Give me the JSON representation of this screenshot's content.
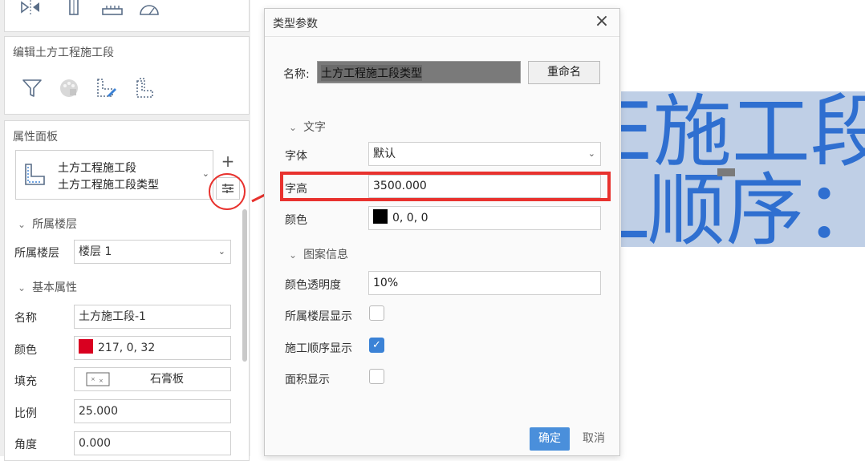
{
  "left_panel": {
    "edit_section": {
      "title": "编辑土方工程施工段"
    },
    "properties": {
      "title": "属性面板",
      "type_selector": {
        "line1": "土方工程施工段",
        "line2": "土方工程施工段类型"
      },
      "sections": {
        "floor": "所属楼层",
        "basic": "基本属性"
      },
      "floor_row": {
        "label": "所属楼层",
        "value": "楼层 1"
      },
      "rows": {
        "name": {
          "label": "名称",
          "value": "土方施工段-1"
        },
        "color": {
          "label": "颜色",
          "value": "217, 0, 32",
          "swatch": "#d90020"
        },
        "fill": {
          "label": "填充",
          "value": "石膏板"
        },
        "scale": {
          "label": "比例",
          "value": "25.000"
        },
        "angle": {
          "label": "角度",
          "value": "0.000"
        }
      }
    }
  },
  "dialog": {
    "title": "类型参数",
    "name_label": "名称:",
    "name_value": "土方工程施工段类型",
    "rename_button": "重命名",
    "sections": {
      "text": "文字",
      "pattern": "图案信息"
    },
    "font": {
      "label": "字体",
      "value": "默认"
    },
    "text_height": {
      "label": "字高",
      "value": "3500.000"
    },
    "text_color": {
      "label": "颜色",
      "value": "0, 0, 0",
      "swatch": "#000000"
    },
    "transparency": {
      "label": "颜色透明度",
      "value": "10%"
    },
    "floor_display": {
      "label": "所属楼层显示",
      "checked": false
    },
    "sequence_display": {
      "label": "施工顺序显示",
      "checked": true
    },
    "area_display": {
      "label": "面积显示",
      "checked": false
    },
    "ok_button": "确定",
    "cancel_button": "取消"
  },
  "canvas": {
    "line1": "E施工段",
    "line2": "L顺序：",
    "highlight_color": "#bfcfe6",
    "text_color": "#2f6fd0"
  },
  "annotation_color": "#e8322e"
}
